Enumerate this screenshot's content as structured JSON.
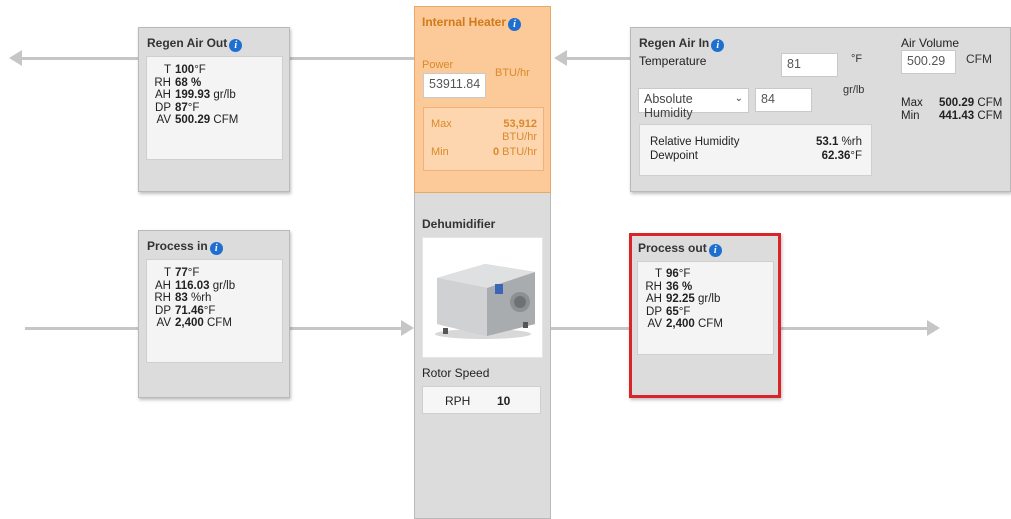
{
  "regen_air_out": {
    "title": "Regen Air Out",
    "rows": [
      {
        "key": "T",
        "value": "100",
        "unit": "°F"
      },
      {
        "key": "RH",
        "value": "68 %",
        "unit": ""
      },
      {
        "key": "AH",
        "value": "199.93",
        "unit": "gr/lb"
      },
      {
        "key": "DP",
        "value": "87",
        "unit": "°F"
      },
      {
        "key": "AV",
        "value": "500.29",
        "unit": "CFM"
      }
    ]
  },
  "internal_heater": {
    "title": "Internal Heater",
    "power_label": "Power",
    "power_value": "53911.84",
    "power_unit": "BTU/hr",
    "max_label": "Max",
    "max_value": "53,912",
    "max_unit": "BTU/hr",
    "min_label": "Min",
    "min_value": "0",
    "min_unit": "BTU/hr"
  },
  "regen_air_in": {
    "title": "Regen Air In",
    "temperature_label": "Temperature",
    "temperature_value": "81",
    "temperature_unit": "°F",
    "humidity_select": "Absolute Humidity",
    "humidity_value": "84",
    "humidity_unit": "gr/lb",
    "rh_label": "Relative Humidity",
    "rh_value": "53.1",
    "rh_unit": "%rh",
    "dp_label": "Dewpoint",
    "dp_value": "62.36",
    "dp_unit": "°F",
    "air_volume_label": "Air Volume",
    "air_volume_value": "500.29",
    "air_volume_unit": "CFM",
    "max_label": "Max",
    "max_value": "500.29",
    "max_unit": "CFM",
    "min_label": "Min",
    "min_value": "441.43",
    "min_unit": "CFM"
  },
  "dehumidifier": {
    "title": "Dehumidifier",
    "rotor_label": "Rotor Speed",
    "rph_label": "RPH",
    "rph_value": "10"
  },
  "process_in": {
    "title": "Process in",
    "rows": [
      {
        "key": "T",
        "value": "77",
        "unit": "°F"
      },
      {
        "key": "AH",
        "value": "116.03",
        "unit": "gr/lb"
      },
      {
        "key": "RH",
        "value": "83",
        "unit": "%rh"
      },
      {
        "key": "DP",
        "value": "71.46",
        "unit": "°F"
      },
      {
        "key": "AV",
        "value": "2,400",
        "unit": "CFM"
      }
    ]
  },
  "process_out": {
    "title": "Process out",
    "rows": [
      {
        "key": "T",
        "value": "96",
        "unit": "°F"
      },
      {
        "key": "RH",
        "value": "36 %",
        "unit": ""
      },
      {
        "key": "AH",
        "value": "92.25",
        "unit": "gr/lb"
      },
      {
        "key": "DP",
        "value": "65",
        "unit": "°F"
      },
      {
        "key": "AV",
        "value": "2,400",
        "unit": "CFM"
      }
    ]
  },
  "colors": {
    "heater_bg": "#fcc999",
    "highlight_border": "#d9252a",
    "info_icon": "#1f6fd0"
  }
}
